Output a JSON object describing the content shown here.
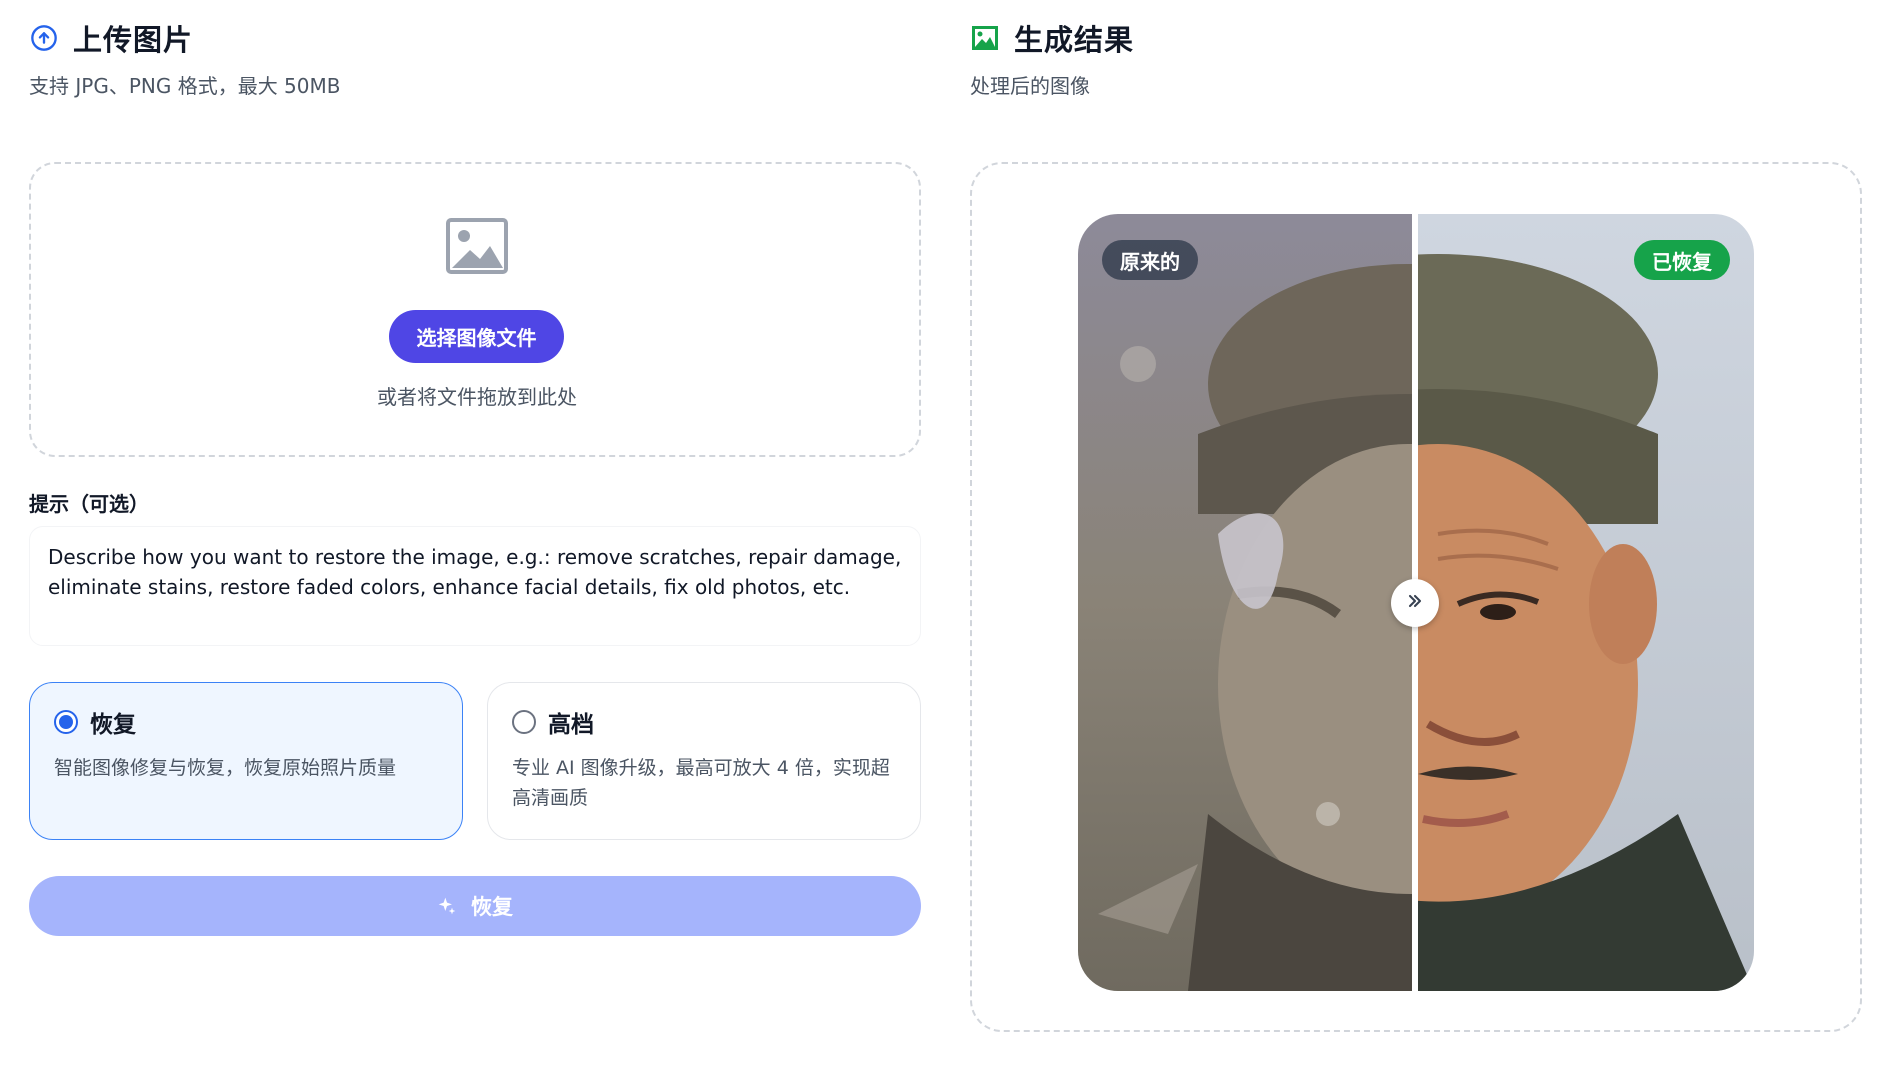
{
  "upload": {
    "title": "上传图片",
    "subtitle": "支持 JPG、PNG 格式，最大 50MB",
    "choose_button": "选择图像文件",
    "drop_hint": "或者将文件拖放到此处"
  },
  "prompt": {
    "label": "提示（可选）",
    "placeholder": "Describe how you want to restore the image, e.g.: remove scratches, repair damage, eliminate stains, restore faded colors, enhance facial details, fix old photos, etc."
  },
  "modes": [
    {
      "title": "恢复",
      "description": "智能图像修复与恢复，恢复原始照片质量",
      "selected": true
    },
    {
      "title": "高档",
      "description": "专业 AI 图像升级，最高可放大 4 倍，实现超高清画质",
      "selected": false
    }
  ],
  "action_button": {
    "label": "恢复",
    "color": "#a5b4fc"
  },
  "result": {
    "title": "生成结果",
    "subtitle": "处理后的图像",
    "before_tag": "原来的",
    "after_tag": "已恢复",
    "slider_position": 0.5
  },
  "colors": {
    "primary": "#4f46e5",
    "selected_border": "#3b82f6",
    "success": "#16a34a",
    "upload_icon": "#2563eb",
    "result_icon": "#16a34a"
  },
  "icons": {
    "upload": "cloud-upload-icon",
    "result": "image-icon",
    "placeholder": "image-placeholder-icon",
    "action": "sparkles-icon",
    "handle": "chevrons-right-icon"
  }
}
